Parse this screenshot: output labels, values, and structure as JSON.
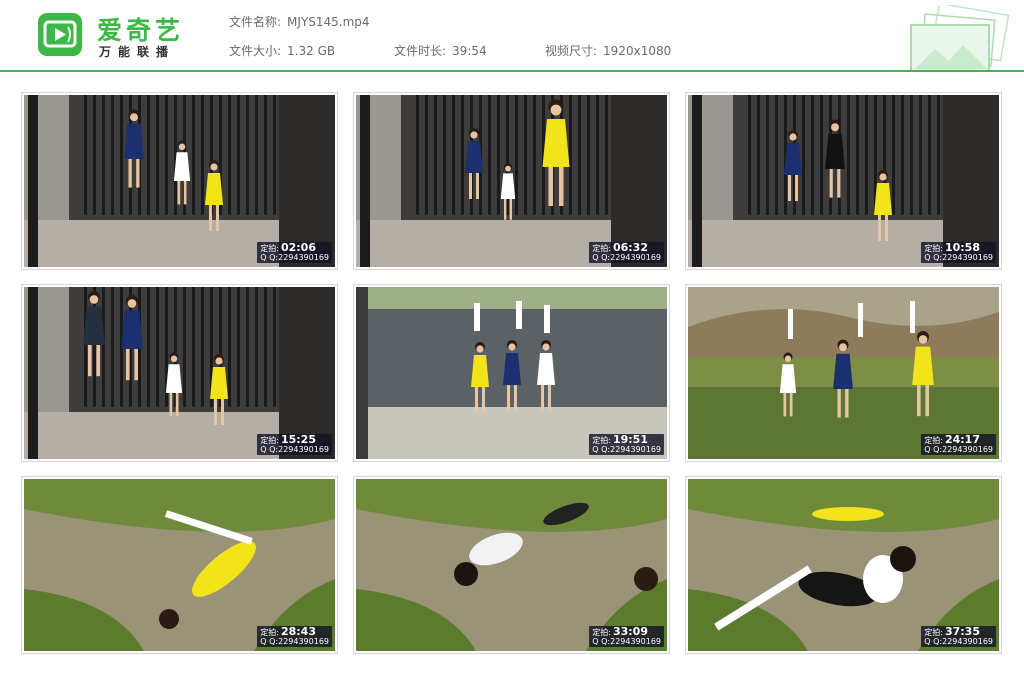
{
  "brand": {
    "name": "爱奇艺",
    "subtitle": "万能联播",
    "color": "#3cb846"
  },
  "file_info": {
    "name_label": "文件名称:",
    "name_value": "MJYS145.mp4",
    "size_label": "文件大小:",
    "size_value": "1.32 GB",
    "duration_label": "文件时长:",
    "duration_value": "39:54",
    "resolution_label": "视频尺寸:",
    "resolution_value": "1920x1080"
  },
  "thumbnails": [
    {
      "time": "02:06",
      "overlay_prefix": "定拍:",
      "qq": "Q Q:2294390169",
      "scene": "cell"
    },
    {
      "time": "06:32",
      "overlay_prefix": "定拍:",
      "qq": "Q Q:2294390169",
      "scene": "cell"
    },
    {
      "time": "10:58",
      "overlay_prefix": "定拍:",
      "qq": "Q Q:2294390169",
      "scene": "cell"
    },
    {
      "time": "15:25",
      "overlay_prefix": "定拍:",
      "qq": "Q Q:2294390169",
      "scene": "cell"
    },
    {
      "time": "19:51",
      "overlay_prefix": "定拍:",
      "qq": "Q Q:2294390169",
      "scene": "courtyard"
    },
    {
      "time": "24:17",
      "overlay_prefix": "定拍:",
      "qq": "Q Q:2294390169",
      "scene": "field"
    },
    {
      "time": "28:43",
      "overlay_prefix": "定拍:",
      "qq": "Q Q:2294390169",
      "scene": "ground"
    },
    {
      "time": "33:09",
      "overlay_prefix": "定拍:",
      "qq": "Q Q:2294390169",
      "scene": "ground"
    },
    {
      "time": "37:35",
      "overlay_prefix": "定拍:",
      "qq": "Q Q:2294390169",
      "scene": "ground"
    }
  ],
  "colors": {
    "accent": "#3cb846",
    "yellow_dress": "#f2e41a",
    "navy_dress": "#1c2f6e"
  }
}
